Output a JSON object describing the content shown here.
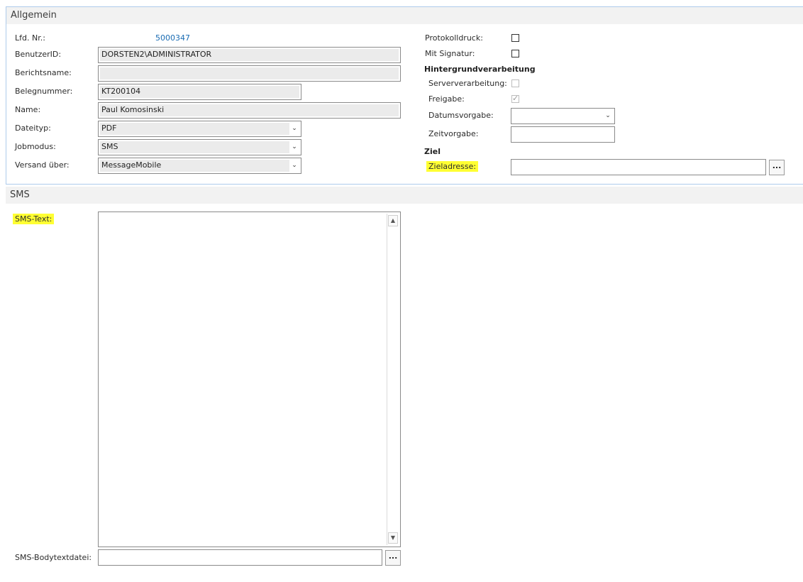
{
  "sections": {
    "allgemein": "Allgemein",
    "sms": "SMS"
  },
  "general": {
    "lfd_nr_label": "Lfd. Nr.:",
    "lfd_nr_value": "5000347",
    "benutzer_label": "BenutzerID:",
    "benutzer_value": "DORSTEN2\\ADMINISTRATOR",
    "berichtsname_label": "Berichtsname:",
    "berichtsname_value": "",
    "belegnummer_label": "Belegnummer:",
    "belegnummer_value": "KT200104",
    "name_label": "Name:",
    "name_value": "Paul Komosinski",
    "dateityp_label": "Dateityp:",
    "dateityp_value": "PDF",
    "jobmodus_label": "Jobmodus:",
    "jobmodus_value": "SMS",
    "versand_label": "Versand über:",
    "versand_value": "MessageMobile"
  },
  "right": {
    "protokolldruck_label": "Protokolldruck:",
    "protokolldruck_checked": false,
    "signatur_label": "Mit Signatur:",
    "signatur_checked": false,
    "hintergrund_heading": "Hintergrundverarbeitung",
    "serververarbeitung_label": "Serververarbeitung:",
    "serververarbeitung_checked": false,
    "freigabe_label": "Freigabe:",
    "freigabe_checked": true,
    "datumsvorgabe_label": "Datumsvorgabe:",
    "datumsvorgabe_value": "",
    "zeitvorgabe_label": "Zeitvorgabe:",
    "zeitvorgabe_value": "",
    "ziel_heading": "Ziel",
    "zieladresse_label": "Zieladresse:",
    "zieladresse_value": "",
    "dots_label": "..."
  },
  "sms": {
    "text_label": "SMS-Text:",
    "text_value": "",
    "bodytext_label": "SMS-Bodytextdatei:",
    "bodytext_value": "",
    "dots_label": "..."
  },
  "colors": {
    "highlight": "#ffff33",
    "link": "#1a6cb3",
    "section_border": "#aecbeb"
  }
}
